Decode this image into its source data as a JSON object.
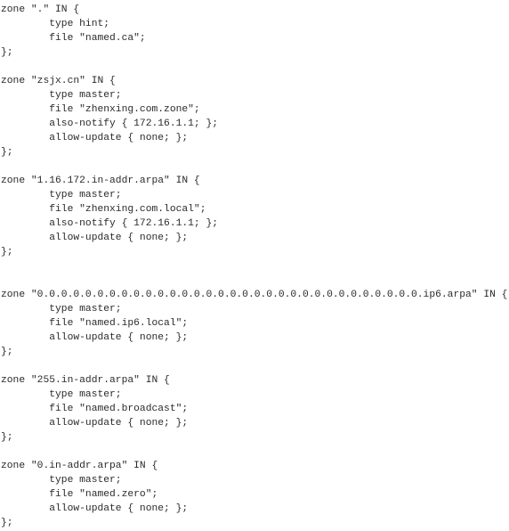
{
  "lines": [
    "zone \".\" IN {",
    "        type hint;",
    "        file \"named.ca\";",
    "};",
    "",
    "zone \"zsjx.cn\" IN {",
    "        type master;",
    "        file \"zhenxing.com.zone\";",
    "        also-notify { 172.16.1.1; };",
    "        allow-update { none; };",
    "};",
    "",
    "zone \"1.16.172.in-addr.arpa\" IN {",
    "        type master;",
    "        file \"zhenxing.com.local\";",
    "        also-notify { 172.16.1.1; };",
    "        allow-update { none; };",
    "};",
    "",
    "",
    "zone \"0.0.0.0.0.0.0.0.0.0.0.0.0.0.0.0.0.0.0.0.0.0.0.0.0.0.0.0.0.0.0.0.ip6.arpa\" IN {",
    "        type master;",
    "        file \"named.ip6.local\";",
    "        allow-update { none; };",
    "};",
    "",
    "zone \"255.in-addr.arpa\" IN {",
    "        type master;",
    "        file \"named.broadcast\";",
    "        allow-update { none; };",
    "};",
    "",
    "zone \"0.in-addr.arpa\" IN {",
    "        type master;",
    "        file \"named.zero\";",
    "        allow-update { none; };",
    "};"
  ]
}
